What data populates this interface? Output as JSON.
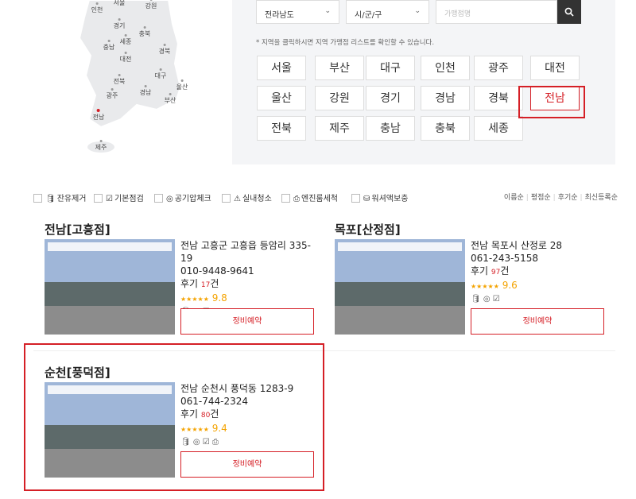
{
  "map": {
    "regions": [
      {
        "key": "incheon",
        "label": "인천"
      },
      {
        "key": "seoul",
        "label": "서울"
      },
      {
        "key": "gangwon",
        "label": "강원"
      },
      {
        "key": "gyeonggi",
        "label": "경기"
      },
      {
        "key": "chungbuk",
        "label": "충북"
      },
      {
        "key": "sejong",
        "label": "세종"
      },
      {
        "key": "chungnam",
        "label": "충남"
      },
      {
        "key": "gyeongbuk",
        "label": "경북"
      },
      {
        "key": "daejeon",
        "label": "대전"
      },
      {
        "key": "daegu",
        "label": "대구"
      },
      {
        "key": "jeonbuk",
        "label": "전북"
      },
      {
        "key": "ulsan",
        "label": "울산"
      },
      {
        "key": "gwangju",
        "label": "광주"
      },
      {
        "key": "gyeongnam",
        "label": "경남"
      },
      {
        "key": "busan",
        "label": "부산"
      },
      {
        "key": "jeonnam",
        "label": "전남",
        "active": true
      },
      {
        "key": "jeju",
        "label": "제주"
      }
    ]
  },
  "filters": {
    "province_select": "전라남도",
    "city_select": "시/군/구",
    "search_placeholder": "가맹점명",
    "hint": "* 지역을 클릭하시면 지역 가맹점 리스트를 확인할 수 있습니다."
  },
  "region_buttons": [
    "서울",
    "부산",
    "대구",
    "인천",
    "광주",
    "대전",
    "울산",
    "강원",
    "경기",
    "경남",
    "경북",
    "전남",
    "전북",
    "제주",
    "충남",
    "충북",
    "세종"
  ],
  "active_region": "전남",
  "services": [
    {
      "label": "잔유제거",
      "icon": "🛢"
    },
    {
      "label": "기본점검",
      "icon": "☑"
    },
    {
      "label": "공기압체크",
      "icon": "◎"
    },
    {
      "label": "실내청소",
      "icon": "⚠"
    },
    {
      "label": "엔진룸세척",
      "icon": "⎙"
    },
    {
      "label": "워셔액보충",
      "icon": "⛁"
    }
  ],
  "sort": [
    "이름순",
    "평점순",
    "후기순",
    "최신등록순"
  ],
  "cards": [
    {
      "title": "전남[고흥점]",
      "address": "전남 고흥군 고흥읍 등암리 335-19",
      "phone": "010-9448-9641",
      "reviews_prefix": "후기",
      "reviews_count": "17",
      "reviews_suffix": "건",
      "stars": "★★★★★",
      "score": "9.8",
      "icons": "🛢 ◎ ☑",
      "reserve": "정비예약"
    },
    {
      "title": "목포[산정점]",
      "address": "전남 목포시 산정로 28",
      "phone": "061-243-5158",
      "reviews_prefix": "후기",
      "reviews_count": "97",
      "reviews_suffix": "건",
      "stars": "★★★★★",
      "score": "9.6",
      "icons": "🛢 ◎ ☑",
      "reserve": "정비예약"
    },
    {
      "title": "순천[풍덕점]",
      "address": "전남 순천시 풍덕동 1283-9",
      "phone": "061-744-2324",
      "reviews_prefix": "후기",
      "reviews_count": "80",
      "reviews_suffix": "건",
      "stars": "★★★★★",
      "score": "9.4",
      "icons": "🛢 ◎ ☑ ⎙",
      "reserve": "정비예약"
    }
  ]
}
